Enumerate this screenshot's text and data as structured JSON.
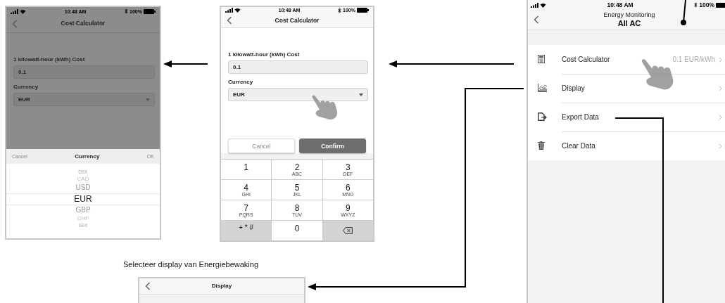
{
  "screens": [
    {
      "kind": "picker",
      "status_bar": {
        "time": "10:48 AM",
        "battery": "100%"
      },
      "title": "Cost Calculator",
      "form": {
        "cost_label": "1 kilowatt-hour (kWh) Cost",
        "cost_value": "0.1",
        "currency_label": "Currency",
        "currency_value": "EUR"
      },
      "picker": {
        "cancel": "Cancel",
        "title": "Currency",
        "ok": "OK",
        "options": [
          {
            "label": "DKK",
            "selected": false
          },
          {
            "label": "CAD",
            "selected": false
          },
          {
            "label": "USD",
            "selected": false
          },
          {
            "label": "EUR",
            "selected": true
          },
          {
            "label": "GBP",
            "selected": false
          },
          {
            "label": "CHF",
            "selected": false
          },
          {
            "label": "SEK",
            "selected": false
          }
        ]
      }
    },
    {
      "kind": "keypad",
      "status_bar": {
        "time": "10:48 AM",
        "battery": "100%"
      },
      "title": "Cost Calculator",
      "form": {
        "cost_label": "1 kilowatt-hour (kWh) Cost",
        "cost_value": "0.1",
        "currency_label": "Currency",
        "currency_value": "EUR"
      },
      "buttons": [
        {
          "label": "Cancel",
          "primary": false
        },
        {
          "label": "Confirm",
          "primary": true
        }
      ],
      "keypad": [
        {
          "kind": "digit",
          "main": "1"
        },
        {
          "kind": "digit",
          "main": "2",
          "sub": "ABC"
        },
        {
          "kind": "digit",
          "main": "3",
          "sub": "DEF"
        },
        {
          "kind": "digit",
          "main": "4",
          "sub": "GHI"
        },
        {
          "kind": "digit",
          "main": "5",
          "sub": "JKL"
        },
        {
          "kind": "digit",
          "main": "6",
          "sub": "MNO"
        },
        {
          "kind": "digit",
          "main": "7",
          "sub": "PQRS"
        },
        {
          "kind": "digit",
          "main": "8",
          "sub": "TUV"
        },
        {
          "kind": "digit",
          "main": "9",
          "sub": "WXYZ"
        },
        {
          "kind": "symbols",
          "main": "+ * #"
        },
        {
          "kind": "digit",
          "main": "0"
        },
        {
          "kind": "delete"
        }
      ]
    },
    {
      "kind": "menu",
      "status_bar": {
        "time": "10:48 AM",
        "battery": "100%"
      },
      "title": "Energy Monitoring",
      "subtitle": "All AC",
      "items": [
        {
          "kind": "calculator",
          "label": "Cost Calculator",
          "value": "0.1 EUR/kWh"
        },
        {
          "kind": "chart",
          "label": "Display"
        },
        {
          "kind": "export",
          "label": "Export Data"
        },
        {
          "kind": "trash",
          "label": "Clear Data"
        }
      ]
    },
    {
      "kind": "blank",
      "title": "Display"
    }
  ],
  "caption": "Selecteer display van Energiebewaking"
}
